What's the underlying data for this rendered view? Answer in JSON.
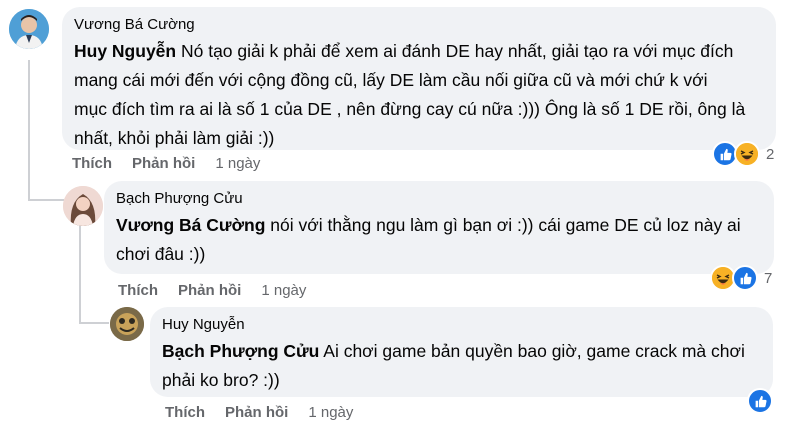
{
  "comments": [
    {
      "author": "Vương Bá Cường",
      "mention": "Huy Nguyễn",
      "text_lines": [
        " Nó tạo giải k phải để xem ai đánh DE hay nhất, giải tạo ra với mục đích",
        "mang cái mới đến với cộng đồng cũ, lấy DE làm cầu nối giữa cũ và mới chứ k với",
        "mục đích tìm ra ai là số 1 của DE , nên đừng cay cú nữa :))) Ông là số 1 DE rồi, ông là",
        "nhất, khỏi phải làm giải :))"
      ],
      "like_label": "Thích",
      "reply_label": "Phản hồi",
      "time": "1 ngày",
      "reaction_count": "2",
      "reaction_icons": [
        "like-icon",
        "haha-icon"
      ]
    },
    {
      "author": "Bạch Phượng Cửu",
      "mention": "Vương Bá Cường",
      "text_lines": [
        " nói với thằng ngu làm gì bạn ơi :)) cái game DE củ loz này ai",
        "chơi đâu :))"
      ],
      "like_label": "Thích",
      "reply_label": "Phản hồi",
      "time": "1 ngày",
      "reaction_count": "7",
      "reaction_icons": [
        "haha-icon",
        "like-icon"
      ]
    },
    {
      "author": "Huy Nguyễn",
      "mention": "Bạch Phượng Cửu",
      "text_lines": [
        " Ai chơi game bản quyền bao giờ, game crack mà chơi",
        "phải ko bro? :))"
      ],
      "like_label": "Thích",
      "reply_label": "Phản hồi",
      "time": "1 ngày",
      "reaction_icons": [
        "like-icon"
      ]
    }
  ],
  "colors": {
    "bubble": "#f0f2f5",
    "meta_text": "#65676b",
    "like_blue": "#1b74e4",
    "haha_yellow": "#f7b125",
    "thread_line": "#ced0d4"
  }
}
